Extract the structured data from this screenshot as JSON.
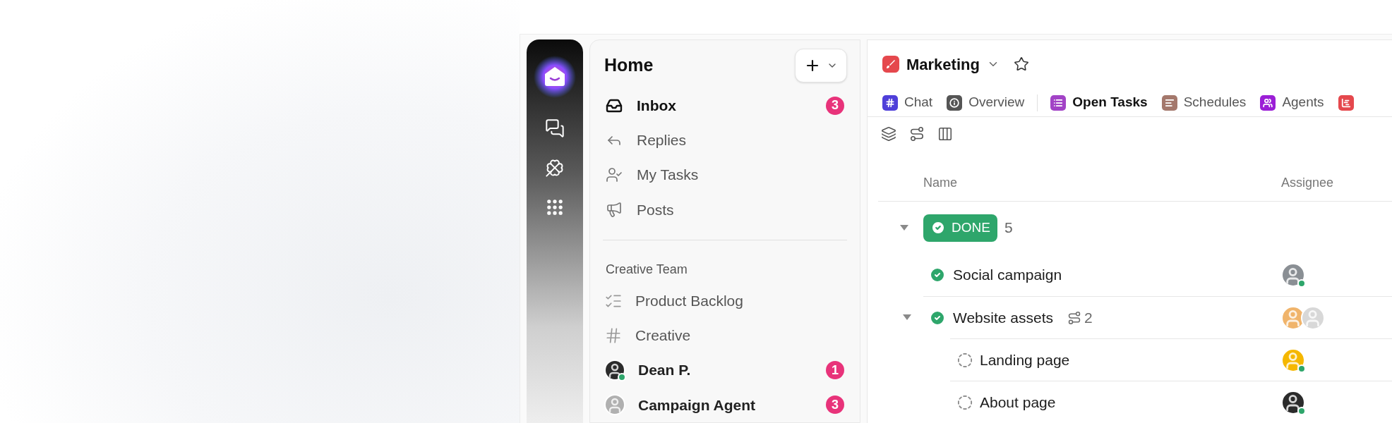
{
  "sidebar": {
    "title": "Home",
    "items": [
      {
        "label": "Inbox",
        "badge": "3"
      },
      {
        "label": "Replies"
      },
      {
        "label": "My Tasks"
      },
      {
        "label": "Posts"
      }
    ],
    "section": {
      "title": "Creative Team",
      "items": [
        {
          "kind": "list",
          "label": "Product Backlog"
        },
        {
          "kind": "channel",
          "label": "Creative"
        },
        {
          "kind": "person",
          "label": "Dean P.",
          "badge": "1",
          "online": true
        },
        {
          "kind": "person",
          "label": "Campaign Agent",
          "badge": "3",
          "online": false
        }
      ]
    }
  },
  "space": {
    "title": "Marketing"
  },
  "tabs": [
    {
      "label": "Chat",
      "color": "#4f3fd9",
      "selected": false
    },
    {
      "label": "Overview",
      "color": "#555555",
      "selected": false
    },
    {
      "label": "Open Tasks",
      "color": "#a243c6",
      "selected": true
    },
    {
      "label": "Schedules",
      "color": "#a4786c",
      "selected": false
    },
    {
      "label": "Agents",
      "color": "#9b1fd6",
      "selected": false
    },
    {
      "color": "#e5484d"
    }
  ],
  "table": {
    "columns": [
      "Name",
      "Assignee"
    ],
    "group": {
      "label": "DONE",
      "count": "5",
      "color": "#2ea66b",
      "expanded": true
    },
    "tasks": [
      {
        "name": "Social campaign",
        "kind": "done",
        "assignees": [
          {
            "online": true
          }
        ]
      },
      {
        "name": "Website assets",
        "kind": "done",
        "subtasks": "2",
        "expanded": true,
        "assignees": [
          {
            "online": false
          },
          {
            "online": false
          }
        ],
        "children": [
          {
            "name": "Landing page",
            "kind": "todo",
            "assignees": [
              {
                "online": true
              }
            ]
          },
          {
            "name": "About page",
            "kind": "todo",
            "assignees": [
              {
                "online": true
              }
            ]
          }
        ]
      }
    ]
  }
}
